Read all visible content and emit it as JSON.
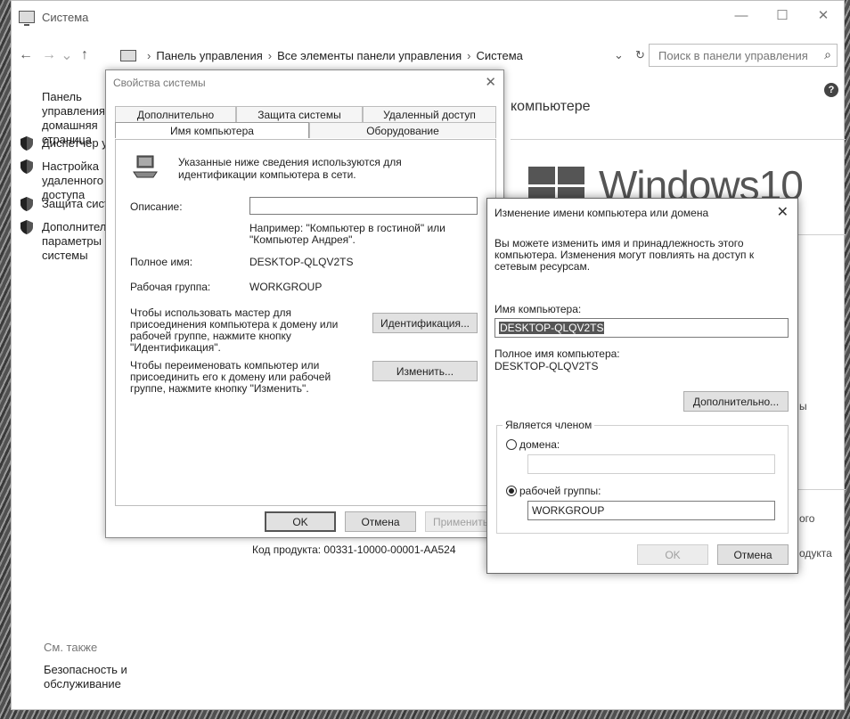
{
  "window": {
    "title": "Система",
    "controls": [
      "—",
      "☐",
      "✕"
    ]
  },
  "nav": {
    "back": "←",
    "forward": "→",
    "recent": "⌄",
    "up": "↑",
    "breadcrumbs": [
      "Панель управления",
      "Все элементы панели управления",
      "Система"
    ],
    "separator": "›",
    "dropdown": "⌄",
    "refresh": "↻",
    "search_placeholder": "Поиск в панели управления",
    "search_glyph": "⌕"
  },
  "help_glyph": "?",
  "left_pane": {
    "home_link": "Панель управления — домашняя страница",
    "items": [
      "Диспетчер устройств",
      "Настройка удаленного доступа",
      "Защита системы",
      "Дополнительные параметры системы"
    ],
    "see_also": "См. также",
    "security_link": "Безопасность и обслуживание"
  },
  "main": {
    "heading": "компьютере",
    "windows_wordmark": "Windows",
    "windows_version": "10",
    "product_key": "Код продукта:  00331-10000-00001-AA524",
    "edge_texts": [
      "ы",
      "ого",
      "одукта"
    ]
  },
  "sysprop": {
    "title": "Свойства системы",
    "close": "✕",
    "tabs_row1": [
      "Дополнительно",
      "Защита системы",
      "Удаленный доступ"
    ],
    "tabs_row2": [
      "Имя компьютера",
      "Оборудование"
    ],
    "desc": "Указанные ниже сведения используются для идентификации компьютера в сети.",
    "description_label": "Описание:",
    "example": "Например: \"Компьютер в гостиной\" или \"Компьютер Андрея\".",
    "full_name_label": "Полное имя:",
    "full_name_value": "DESKTOP-QLQV2TS",
    "workgroup_label": "Рабочая группа:",
    "workgroup_value": "WORKGROUP",
    "identify_text": "Чтобы использовать мастер для присоединения компьютера к домену или рабочей группе, нажмите кнопку \"Идентификация\".",
    "identify_button": "Идентификация...",
    "rename_text": "Чтобы переименовать компьютер или присоединить его к домену или рабочей группе, нажмите кнопку \"Изменить\".",
    "change_button": "Изменить...",
    "ok": "OK",
    "cancel": "Отмена",
    "apply": "Применить"
  },
  "rename": {
    "title": "Изменение имени компьютера или домена",
    "close": "✕",
    "intro": "Вы можете изменить имя и принадлежность этого компьютера. Изменения могут повлиять на доступ к сетевым ресурсам.",
    "computer_name_label": "Имя компьютера:",
    "computer_name_value": "DESKTOP-QLQV2TS",
    "full_name_label": "Полное имя компьютера:",
    "full_name_value": "DESKTOP-QLQV2TS",
    "more_button": "Дополнительно...",
    "member_of": "Является членом",
    "domain_label": "домена:",
    "domain_value": "",
    "workgroup_label": "рабочей группы:",
    "workgroup_value": "WORKGROUP",
    "ok": "OK",
    "cancel": "Отмена"
  }
}
